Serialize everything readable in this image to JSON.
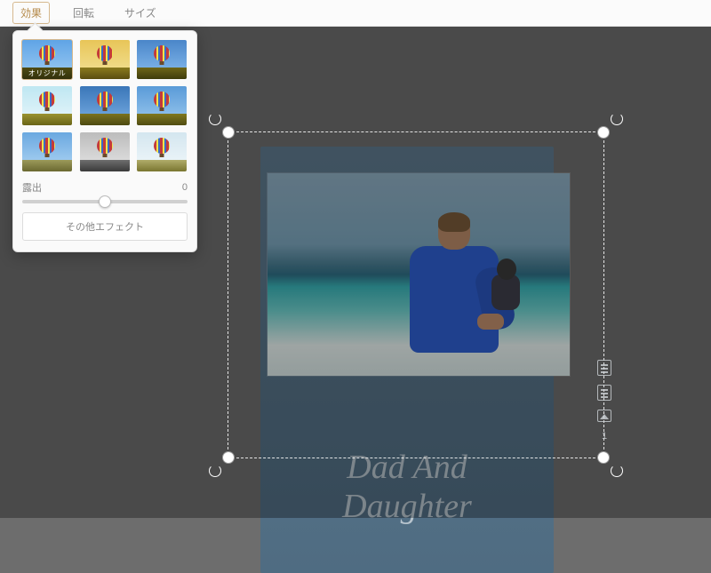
{
  "toolbar": {
    "tabs": [
      {
        "label": "効果",
        "active": true
      },
      {
        "label": "回転",
        "active": false
      },
      {
        "label": "サイズ",
        "active": false
      }
    ]
  },
  "effects_panel": {
    "thumbnails": [
      {
        "label": "オリジナル",
        "selected": true
      },
      {
        "label": ""
      },
      {
        "label": ""
      },
      {
        "label": ""
      },
      {
        "label": ""
      },
      {
        "label": ""
      },
      {
        "label": ""
      },
      {
        "label": ""
      },
      {
        "label": ""
      }
    ],
    "slider": {
      "label": "露出",
      "value": "0"
    },
    "more_button": "その他エフェクト",
    "filter_styles": [
      {
        "sky": "linear-gradient(180deg,#5fa4e6,#a0cdf3)",
        "ground": "linear-gradient(180deg,#7a751e,#4d4a12)"
      },
      {
        "sky": "linear-gradient(180deg,#e8c558,#f3e49a)",
        "ground": "linear-gradient(180deg,#8a7a1e,#5a4d10)"
      },
      {
        "sky": "linear-gradient(180deg,#4a86c9,#8abef0)",
        "ground": "linear-gradient(180deg,#6e6618,#3f3c0c)"
      },
      {
        "sky": "linear-gradient(180deg,#bfe7f2,#e8f6fb)",
        "ground": "linear-gradient(180deg,#9a9230,#6a6518)"
      },
      {
        "sky": "linear-gradient(180deg,#3a76b8,#7ab0e5)",
        "ground": "linear-gradient(180deg,#7a721e,#4d4a12)"
      },
      {
        "sky": "linear-gradient(180deg,#5a9bd8,#9cc9ef)",
        "ground": "linear-gradient(180deg,#807820,#514d12)"
      },
      {
        "sky": "linear-gradient(180deg,#6aa8e0,#b0d6f4)",
        "ground": "linear-gradient(180deg,#9c9a5a,#6a6830)"
      },
      {
        "sky": "linear-gradient(180deg,#bcbcbc,#e6e6e6)",
        "ground": "linear-gradient(180deg,#6e6e6e,#3a3a3a)"
      },
      {
        "sky": "linear-gradient(180deg,#d4e6ef,#f1f8fb)",
        "ground": "linear-gradient(180deg,#b0ac6a,#7a7630)"
      }
    ]
  },
  "canvas": {
    "card_text_line1": "Dad And",
    "card_text_line2": "Daughter",
    "side_count": "1"
  }
}
